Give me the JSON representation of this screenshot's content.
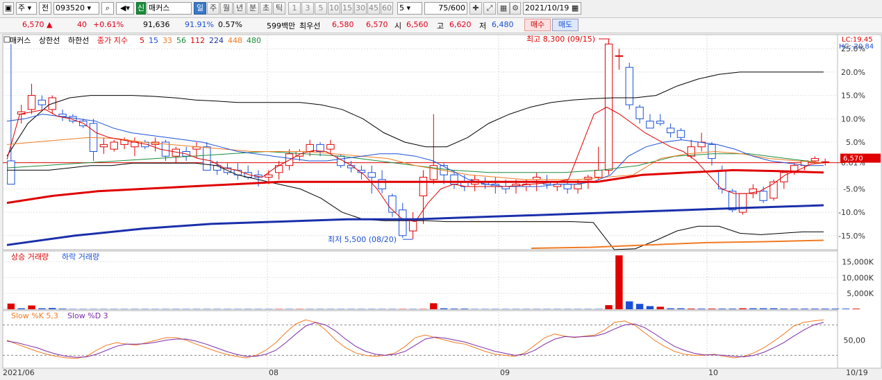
{
  "toolbar": {
    "market": "주",
    "period_type": "전",
    "code": "093520",
    "badge": "신",
    "name": "매커스",
    "period_tabs": [
      "일",
      "주",
      "월",
      "년",
      "분",
      "초",
      "틱"
    ],
    "active_period": "일",
    "intervals": [
      "1",
      "3",
      "5",
      "10",
      "15",
      "30",
      "45",
      "60"
    ],
    "interval_value": "5",
    "count": "75/600",
    "date": "2021/10/19"
  },
  "info": {
    "price": "6,570",
    "change": "40",
    "change_pct": "+0.61%",
    "volume": "91,636",
    "ratio": "91.91%",
    "turnover": "0.57%",
    "amount": "599백만",
    "best_label": "최우선",
    "best_ask": "6,580",
    "best_bid": "6,570",
    "open_label": "시",
    "open": "6,560",
    "high_label": "고",
    "high": "6,620",
    "low_label": "저",
    "low": "6,480",
    "buy_label": "매수",
    "sell_label": "매도"
  },
  "chart_data": {
    "type": "candlestick",
    "price_panel": {
      "legend": [
        "매커스",
        "상한선",
        "하한선",
        "종가 지수",
        "5",
        "15",
        "33",
        "56",
        "112",
        "224",
        "448",
        "480"
      ],
      "y_axis": [
        "25.0%",
        "20.0%",
        "15.0%",
        "10.0%",
        "5.0%",
        "0.61%",
        "-5.0%",
        "-10.0%",
        "-15.0%"
      ],
      "y_pct_range": [
        -18,
        28
      ],
      "base_price": 6530,
      "corner_labels": [
        "LC:19.45",
        "HC:-20.84"
      ],
      "current_label": "6,570",
      "annotations": [
        {
          "text": "최고 8,300 (09/15)",
          "pct": 27.1
        },
        {
          "text": "최저 5,500 (08/20)",
          "pct": -15.8
        }
      ],
      "candles": [
        {
          "o": 1,
          "h": 26,
          "l": -1,
          "c": -4
        },
        {
          "o": 11,
          "h": 13,
          "l": 9,
          "c": 11.5
        },
        {
          "o": 12,
          "h": 17.5,
          "l": 11,
          "c": 15
        },
        {
          "o": 14,
          "h": 15,
          "l": 12,
          "c": 13
        },
        {
          "o": 12,
          "h": 15,
          "l": 11,
          "c": 14.5
        },
        {
          "o": 11,
          "h": 12,
          "l": 9.5,
          "c": 10.5
        },
        {
          "o": 10.5,
          "h": 11,
          "l": 9,
          "c": 9.5
        },
        {
          "o": 9.5,
          "h": 10,
          "l": 8,
          "c": 8.5
        },
        {
          "o": 9,
          "h": 10,
          "l": 1,
          "c": 3
        },
        {
          "o": 4,
          "h": 6,
          "l": 2.5,
          "c": 4.5
        },
        {
          "o": 3.5,
          "h": 5.5,
          "l": 3,
          "c": 5
        },
        {
          "o": 4.5,
          "h": 6,
          "l": 3.5,
          "c": 5.5
        },
        {
          "o": 4,
          "h": 6,
          "l": 2,
          "c": 5
        },
        {
          "o": 5,
          "h": 5.5,
          "l": 3.5,
          "c": 4
        },
        {
          "o": 4.5,
          "h": 6,
          "l": 3,
          "c": 5
        },
        {
          "o": 5,
          "h": 5.5,
          "l": 1,
          "c": 2
        },
        {
          "o": 2,
          "h": 4,
          "l": 0.5,
          "c": 3.5
        },
        {
          "o": 3,
          "h": 4,
          "l": 1,
          "c": 2
        },
        {
          "o": 3.5,
          "h": 5,
          "l": 1.5,
          "c": 4
        },
        {
          "o": 4,
          "h": 5,
          "l": -1,
          "c": -1
        },
        {
          "o": 0,
          "h": 1,
          "l": -2,
          "c": -1
        },
        {
          "o": -0.5,
          "h": 0.5,
          "l": -2,
          "c": -1.5
        },
        {
          "o": -1,
          "h": 0.5,
          "l": -3,
          "c": -2
        },
        {
          "o": -1.5,
          "h": 0,
          "l": -3,
          "c": -2.5
        },
        {
          "o": -2,
          "h": -1,
          "l": -4.5,
          "c": -2.5
        },
        {
          "o": -2.5,
          "h": -1,
          "l": -4,
          "c": -2
        },
        {
          "o": -1.5,
          "h": 1,
          "l": -3,
          "c": 0
        },
        {
          "o": 0,
          "h": 3.5,
          "l": -1,
          "c": 2.5
        },
        {
          "o": 2,
          "h": 3.5,
          "l": 1,
          "c": 3
        },
        {
          "o": 3,
          "h": 5.5,
          "l": 2,
          "c": 4.5
        },
        {
          "o": 4.5,
          "h": 5,
          "l": 2,
          "c": 3
        },
        {
          "o": 3.5,
          "h": 5.5,
          "l": 2.5,
          "c": 4.5
        },
        {
          "o": 2,
          "h": 2.5,
          "l": -0.5,
          "c": 0
        },
        {
          "o": 0,
          "h": 1,
          "l": -1.5,
          "c": -0.5
        },
        {
          "o": -1,
          "h": 0,
          "l": -3,
          "c": -1.5
        },
        {
          "o": -1.5,
          "h": 0,
          "l": -6,
          "c": -2.5
        },
        {
          "o": -3,
          "h": -1,
          "l": -6,
          "c": -5
        },
        {
          "o": -6.5,
          "h": -6,
          "l": -11,
          "c": -10
        },
        {
          "o": -9.5,
          "h": -8,
          "l": -15.5,
          "c": -15
        },
        {
          "o": -14,
          "h": -10,
          "l": -15.8,
          "c": -11.5
        },
        {
          "o": -6.5,
          "h": -1,
          "l": -12.5,
          "c": -2.5
        },
        {
          "o": -3,
          "h": 11,
          "l": -4,
          "c": 0
        },
        {
          "o": 0,
          "h": 0.5,
          "l": -4,
          "c": -2
        },
        {
          "o": -2,
          "h": -1,
          "l": -5,
          "c": -4
        },
        {
          "o": -3.5,
          "h": -2,
          "l": -5.5,
          "c": -4.5
        },
        {
          "o": -4,
          "h": -2,
          "l": -5.5,
          "c": -3
        },
        {
          "o": -3.5,
          "h": -2.5,
          "l": -5,
          "c": -4
        },
        {
          "o": -4,
          "h": -2.5,
          "l": -6,
          "c": -4.5
        },
        {
          "o": -4.5,
          "h": -3,
          "l": -6,
          "c": -5
        },
        {
          "o": -4.5,
          "h": -3,
          "l": -6,
          "c": -4
        },
        {
          "o": -4.5,
          "h": -3,
          "l": -5.5,
          "c": -4
        },
        {
          "o": -3,
          "h": -1.5,
          "l": -5.5,
          "c": -2.5
        },
        {
          "o": -3.5,
          "h": -2,
          "l": -5,
          "c": -4
        },
        {
          "o": -4.5,
          "h": -3.5,
          "l": -5.5,
          "c": -4
        },
        {
          "o": -4,
          "h": -3,
          "l": -6,
          "c": -5
        },
        {
          "o": -5,
          "h": -3,
          "l": -6,
          "c": -4
        },
        {
          "o": -3,
          "h": -2,
          "l": -5,
          "c": -2.5
        },
        {
          "o": -2.5,
          "h": 4,
          "l": -3,
          "c": -1
        },
        {
          "o": -1,
          "h": 27,
          "l": -2,
          "c": 26
        },
        {
          "o": 23.5,
          "h": 25,
          "l": 20.5,
          "c": 23.5
        },
        {
          "o": 21,
          "h": 22,
          "l": 12,
          "c": 13
        },
        {
          "o": 12.5,
          "h": 13,
          "l": 9,
          "c": 10
        },
        {
          "o": 9.5,
          "h": 11,
          "l": 8,
          "c": 8
        },
        {
          "o": 9.5,
          "h": 11,
          "l": 8.5,
          "c": 9
        },
        {
          "o": 8,
          "h": 9,
          "l": 6,
          "c": 7
        },
        {
          "o": 7.5,
          "h": 8,
          "l": 5.5,
          "c": 6
        },
        {
          "o": 2,
          "h": 5.5,
          "l": 1.5,
          "c": 4
        },
        {
          "o": 4,
          "h": 7,
          "l": 3,
          "c": 5
        },
        {
          "o": 4.5,
          "h": 5,
          "l": 0,
          "c": 1.5
        },
        {
          "o": -1,
          "h": 0,
          "l": -6,
          "c": -5
        },
        {
          "o": -5.5,
          "h": -5,
          "l": -10,
          "c": -9.5
        },
        {
          "o": -10,
          "h": -6,
          "l": -10.5,
          "c": -6
        },
        {
          "o": -6,
          "h": -4,
          "l": -7,
          "c": -5
        },
        {
          "o": -5.5,
          "h": -4.5,
          "l": -8,
          "c": -7.5
        },
        {
          "o": -7,
          "h": -3,
          "l": -7.5,
          "c": -3.5
        },
        {
          "o": -3.5,
          "h": -1.5,
          "l": -5,
          "c": -1.5
        },
        {
          "o": -1.5,
          "h": 0.5,
          "l": -2,
          "c": 0
        },
        {
          "o": 0,
          "h": 1,
          "l": -1,
          "c": 1
        },
        {
          "o": 1,
          "h": 2,
          "l": 0.5,
          "c": 1.5
        },
        {
          "o": 0.8,
          "h": 1.5,
          "l": 0,
          "c": 0.8
        }
      ],
      "ma_bands": {
        "upper": [
          2,
          9,
          13,
          14.5,
          15,
          15,
          15,
          14.8,
          14.5,
          14,
          13.8,
          13.5,
          13.5,
          13.5,
          13.5,
          13,
          12,
          10,
          7,
          5,
          4,
          4,
          6,
          9,
          11,
          12.5,
          13.5,
          14,
          14.3,
          14.5,
          14.5,
          15,
          17,
          18.5,
          19.5,
          20,
          20,
          20,
          20,
          20
        ],
        "lower": [
          -1,
          -1,
          -1,
          -0.5,
          0,
          0,
          0.5,
          0.5,
          0.5,
          0.5,
          0,
          -2,
          -3,
          -4,
          -5,
          -7,
          -10,
          -11.5,
          -11.8,
          -11.8,
          -11.8,
          -12,
          -12,
          -12,
          -12,
          -12,
          -12,
          -12,
          -12.2,
          -18,
          -17.8,
          -16,
          -14,
          -13,
          -13,
          -14.5,
          -14.8,
          -14.5,
          -14.2,
          -14.2
        ],
        "ma5": [
          1.3,
          11,
          11.5,
          12,
          10.5,
          10,
          9,
          7,
          6,
          5.5,
          5,
          4.5,
          3.5,
          3,
          2.5,
          1.5,
          1,
          -0.5,
          -1,
          -2,
          -2.5,
          -0.5,
          1,
          2.5,
          3.2,
          3,
          1.5,
          0,
          -2,
          -5,
          -9,
          -11.5,
          -12,
          -8,
          -5,
          -4,
          -4.5,
          -4.5,
          -4.5,
          -4.5,
          -4.3,
          -4,
          -3.8,
          -3.5,
          -3,
          4,
          11,
          12.5,
          11,
          9,
          7,
          5.5,
          4,
          3,
          1,
          -2,
          -5,
          -6,
          -6,
          -5.5,
          -4,
          -2,
          -1,
          0.3,
          0.6
        ],
        "ma15": [
          9.5,
          10,
          11,
          10.5,
          10,
          9.5,
          8,
          7,
          6.5,
          6,
          5.5,
          5,
          4,
          3,
          2.5,
          2,
          1.5,
          1,
          1,
          1.5,
          2,
          2.5,
          2.5,
          2,
          1,
          -1,
          -3,
          -4,
          -4.5,
          -4.5,
          -4.5,
          -4,
          -4,
          -3.5,
          -2,
          2,
          4,
          5,
          5.5,
          5,
          4.5,
          3.5,
          2,
          1,
          0.5,
          0,
          0
        ],
        "ma33": [
          4.5,
          5,
          5.5,
          6,
          5.8,
          5,
          4.5,
          4,
          3.5,
          3,
          3,
          3,
          2.5,
          2,
          1.5,
          0,
          -1,
          -2,
          -2.5,
          -3,
          -3,
          -3,
          -2.5,
          -2,
          1.5,
          2.5,
          3,
          2.5,
          1.5,
          1,
          0.6
        ],
        "ma56": [
          -0.5,
          0,
          0.5,
          1,
          1.5,
          2,
          2.5,
          3,
          2.5,
          2,
          1,
          0,
          -1,
          -1.5,
          -1.5,
          -1.5,
          -1,
          0,
          2,
          2.5,
          2.5,
          1.5,
          0.5
        ],
        "ma112": [
          -8,
          -6.5,
          -5.5,
          -5,
          -4.5,
          -4,
          -3.5,
          -3.5,
          -3.5,
          -3.5,
          -3.5,
          -3.5,
          -3.5,
          -3.5,
          -2,
          -1.5,
          -1,
          -1.2,
          -1.5
        ],
        "ma224": [
          -17,
          -15,
          -13.5,
          -12.5,
          -12,
          -11.5,
          -11.5,
          -11,
          -10.5,
          -10,
          -9.5,
          -9,
          -8.5
        ],
        "ma448": [
          -17.7,
          -17.5,
          -17,
          -16.5,
          -16.3,
          -16
        ]
      }
    },
    "volume_panel": {
      "legend": [
        "상승 거래량",
        "하락 거래량"
      ],
      "y_axis": [
        "15,000K",
        "10,000K",
        "5,000K"
      ],
      "y_max": 17500,
      "values_k": [
        1800,
        300,
        1200,
        300,
        400,
        200,
        100,
        100,
        100,
        100,
        100,
        100,
        100,
        100,
        100,
        100,
        100,
        100,
        100,
        100,
        100,
        100,
        100,
        100,
        100,
        100,
        100,
        100,
        100,
        100,
        100,
        100,
        100,
        100,
        100,
        100,
        100,
        100,
        100,
        100,
        100,
        1900,
        300,
        200,
        200,
        100,
        100,
        100,
        100,
        100,
        100,
        100,
        100,
        100,
        100,
        100,
        100,
        100,
        1300,
        17000,
        2500,
        1700,
        1000,
        800,
        300,
        300,
        200,
        200,
        200,
        200,
        200,
        300,
        300,
        300,
        300,
        200,
        200,
        200,
        200,
        200,
        200,
        200,
        200
      ],
      "up_flags": [
        1,
        0,
        1,
        0,
        0,
        0,
        0,
        0,
        0,
        0,
        0,
        0,
        0,
        0,
        0,
        0,
        0,
        0,
        0,
        0,
        0,
        0,
        0,
        0,
        0,
        0,
        1,
        0,
        1,
        0,
        0,
        0,
        0,
        0,
        0,
        0,
        0,
        0,
        1,
        0,
        1,
        1,
        0,
        0,
        0,
        0,
        0,
        0,
        0,
        0,
        0,
        0,
        0,
        0,
        0,
        0,
        0,
        0,
        1,
        1,
        0,
        0,
        0,
        1,
        0,
        0,
        1,
        0,
        1,
        0,
        0,
        1,
        0,
        0,
        0,
        0,
        0,
        0,
        0,
        0,
        0,
        0,
        1,
        0,
        0
      ]
    },
    "stoch_panel": {
      "legend": [
        "Slow %K 5,3",
        "Slow %D 3"
      ],
      "y_axis": [
        "50,00"
      ],
      "y_range": [
        0,
        100
      ],
      "upper_band": 80,
      "lower_band": 20,
      "k": [
        50,
        42,
        35,
        28,
        22,
        18,
        15,
        14,
        18,
        30,
        40,
        45,
        42,
        40,
        45,
        50,
        55,
        55,
        50,
        42,
        35,
        28,
        22,
        18,
        15,
        20,
        30,
        45,
        65,
        82,
        90,
        85,
        70,
        50,
        35,
        25,
        20,
        18,
        20,
        25,
        38,
        55,
        60,
        55,
        50,
        45,
        42,
        35,
        28,
        22,
        20,
        18,
        25,
        40,
        55,
        62,
        58,
        55,
        58,
        60,
        70,
        85,
        88,
        80,
        65,
        50,
        38,
        28,
        22,
        20,
        20,
        22,
        18,
        15,
        18,
        25,
        35,
        48,
        62,
        78,
        85,
        88,
        90
      ],
      "d": [
        48,
        45,
        40,
        35,
        28,
        22,
        18,
        16,
        17,
        22,
        30,
        38,
        42,
        42,
        43,
        46,
        50,
        52,
        52,
        48,
        42,
        35,
        28,
        22,
        18,
        18,
        22,
        30,
        45,
        62,
        78,
        85,
        80,
        68,
        52,
        38,
        28,
        22,
        20,
        22,
        28,
        40,
        52,
        56,
        54,
        50,
        46,
        40,
        34,
        28,
        24,
        20,
        22,
        30,
        42,
        52,
        57,
        56,
        57,
        58,
        63,
        72,
        80,
        82,
        75,
        63,
        50,
        38,
        30,
        24,
        21,
        21,
        20,
        18,
        17,
        20,
        26,
        35,
        45,
        58,
        70,
        80,
        85
      ]
    },
    "x_axis": [
      "2021/06",
      "08",
      "09",
      "10",
      "10/19"
    ]
  }
}
